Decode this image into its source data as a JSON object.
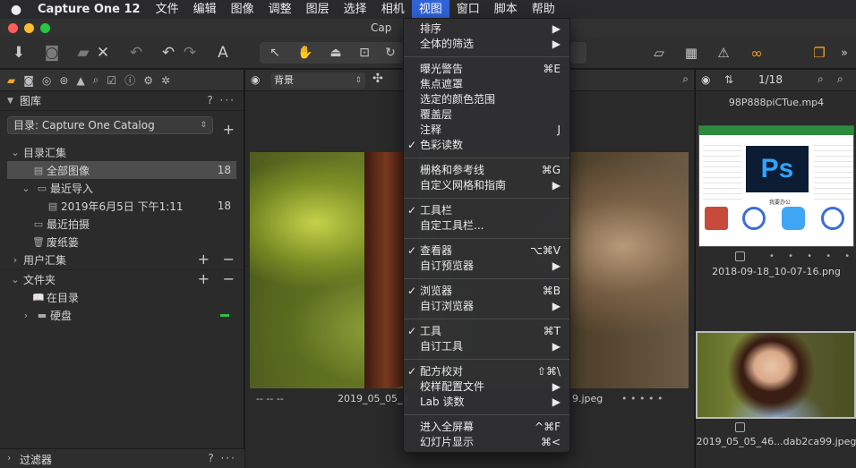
{
  "menubar": {
    "apple": "",
    "app_name": "Capture One 12",
    "items": [
      "文件",
      "编辑",
      "图像",
      "调整",
      "图层",
      "选择",
      "相机",
      "视图",
      "窗口",
      "脚本",
      "帮助"
    ],
    "active_index": 7
  },
  "window": {
    "title": "Cap"
  },
  "left_panel": {
    "library_title": "图库",
    "library_actions": "? ···",
    "catalog_select": "目录: Capture One Catalog",
    "catalog_collections_title": "目录汇集",
    "all_images_label": "全部图像",
    "all_images_count": "18",
    "recent_imports_label": "最近导入",
    "import_date_label": "2019年6月5日 下午1:11",
    "import_date_count": "18",
    "recent_captures_label": "最近拍摄",
    "trash_label": "废纸篓",
    "user_collections_title": "用户汇集",
    "folders_title": "文件夹",
    "in_catalog_label": "在目录",
    "hard_disk_label": "硬盘",
    "filters_title": "过滤器",
    "filters_actions": "? ···"
  },
  "viewer": {
    "background_select": "背景",
    "caption_left": "--    --    --",
    "caption_file": "2019_05_05_4",
    "caption_ext": "9.jpeg",
    "caption_dots": "• • • • •"
  },
  "browser": {
    "counter": "1/18",
    "video_name": "98P888piCTue.mp4",
    "thumb1_name": "2018-09-18_10-07-16.png",
    "thumb1_title": "我要办公",
    "thumb1_ps": "Ps",
    "thumb1_dots": "• • • • •",
    "thumb2_name": "2019_05_05_46...dab2ca99.jpeg"
  },
  "view_menu": {
    "items": [
      {
        "label": "排序",
        "shortcut": "▶",
        "checked": false
      },
      {
        "label": "全体的筛选",
        "shortcut": "▶",
        "checked": false
      },
      {
        "label": "曝光警告",
        "shortcut": "⌘E",
        "checked": false
      },
      {
        "label": "焦点遮罩",
        "shortcut": "",
        "checked": false
      },
      {
        "label": "选定的颜色范围",
        "shortcut": "",
        "checked": false
      },
      {
        "label": "覆盖层",
        "shortcut": "",
        "checked": false
      },
      {
        "label": "注释",
        "shortcut": "J",
        "checked": false
      },
      {
        "label": "色彩读数",
        "shortcut": "",
        "checked": true
      },
      {
        "label": "栅格和参考线",
        "shortcut": "⌘G",
        "checked": false
      },
      {
        "label": "自定义网格和指南",
        "shortcut": "▶",
        "checked": false
      },
      {
        "label": "工具栏",
        "shortcut": "",
        "checked": true
      },
      {
        "label": "自定工具栏...",
        "shortcut": "",
        "checked": false
      },
      {
        "label": "查看器",
        "shortcut": "⌥⌘V",
        "checked": true
      },
      {
        "label": "自订预览器",
        "shortcut": "▶",
        "checked": false
      },
      {
        "label": "浏览器",
        "shortcut": "⌘B",
        "checked": true
      },
      {
        "label": "自订浏览器",
        "shortcut": "▶",
        "checked": false
      },
      {
        "label": "工具",
        "shortcut": "⌘T",
        "checked": true
      },
      {
        "label": "自订工具",
        "shortcut": "▶",
        "checked": false
      },
      {
        "label": "配方校对",
        "shortcut": "⇧⌘\\",
        "checked": true
      },
      {
        "label": "校样配置文件",
        "shortcut": "▶",
        "checked": false
      },
      {
        "label": "Lab 读数",
        "shortcut": "▶",
        "checked": false
      },
      {
        "label": "进入全屏幕",
        "shortcut": "^⌘F",
        "checked": false
      },
      {
        "label": "幻灯片显示",
        "shortcut": "⌘<",
        "checked": false
      }
    ],
    "check_glyph": "✓"
  },
  "colors": {
    "menu_highlight": "#2f63d8",
    "active_tab": "#f5a623",
    "status_green": "#2fc04a",
    "toolbar_accent": "#f0a020"
  }
}
